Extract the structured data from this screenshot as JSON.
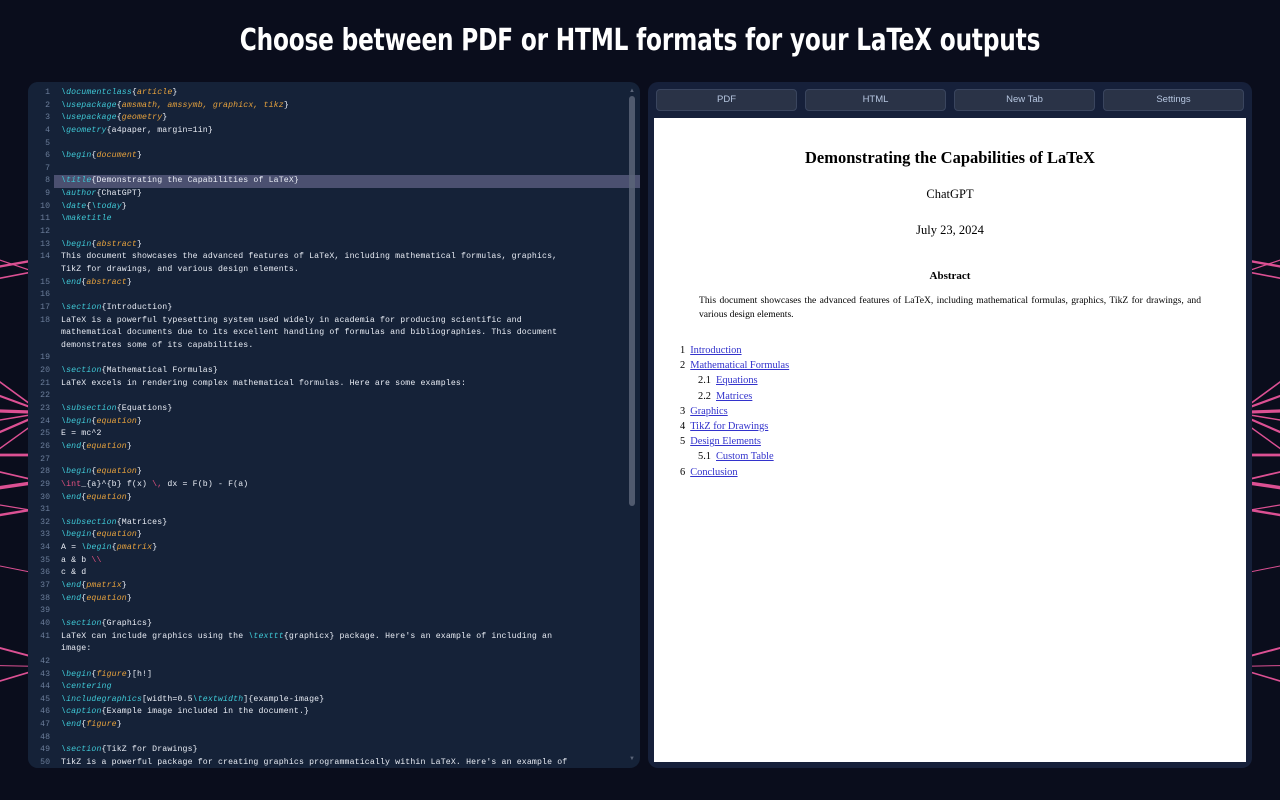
{
  "headline": "Choose between PDF or HTML formats for your LaTeX outputs",
  "colors": {
    "page_bg": "#0a0d1c",
    "panel_bg": "#152238",
    "preview_bg": "#16203a",
    "accent_pink": "#e8549a",
    "cmd_cyan": "#3fc9d6",
    "env_orange": "#e8a33d",
    "math_pink": "#e0507f",
    "link_blue": "#3333cc",
    "button_bg": "#2a3347"
  },
  "toolbar": {
    "buttons": [
      {
        "label": "PDF",
        "name": "pdf-button"
      },
      {
        "label": "HTML",
        "name": "html-button"
      },
      {
        "label": "New Tab",
        "name": "new-tab-button"
      },
      {
        "label": "Settings",
        "name": "settings-button"
      }
    ]
  },
  "editor": {
    "active_line": 8,
    "total_visible_lines": 50,
    "scrollbar": {
      "up_arrow": "▲",
      "down_arrow": "▼"
    },
    "lines": [
      {
        "n": 1,
        "wrap": 1,
        "tokens": [
          {
            "t": "cmd",
            "v": "\\documentclass"
          },
          {
            "t": "brc",
            "v": "{"
          },
          {
            "t": "env",
            "v": "article"
          },
          {
            "t": "brc",
            "v": "}"
          }
        ]
      },
      {
        "n": 2,
        "wrap": 1,
        "tokens": [
          {
            "t": "cmd",
            "v": "\\usepackage"
          },
          {
            "t": "brc",
            "v": "{"
          },
          {
            "t": "env",
            "v": "amsmath, amssymb, graphicx, tikz"
          },
          {
            "t": "brc",
            "v": "}"
          }
        ]
      },
      {
        "n": 3,
        "wrap": 1,
        "tokens": [
          {
            "t": "cmd",
            "v": "\\usepackage"
          },
          {
            "t": "brc",
            "v": "{"
          },
          {
            "t": "env",
            "v": "geometry"
          },
          {
            "t": "brc",
            "v": "}"
          }
        ]
      },
      {
        "n": 4,
        "wrap": 1,
        "tokens": [
          {
            "t": "cmd",
            "v": "\\geometry"
          },
          {
            "t": "txt",
            "v": "{a4paper, margin=1in}"
          }
        ]
      },
      {
        "n": 5,
        "wrap": 1,
        "tokens": []
      },
      {
        "n": 6,
        "wrap": 1,
        "tokens": [
          {
            "t": "cmd",
            "v": "\\begin"
          },
          {
            "t": "brc",
            "v": "{"
          },
          {
            "t": "env",
            "v": "document"
          },
          {
            "t": "brc",
            "v": "}"
          }
        ]
      },
      {
        "n": 7,
        "wrap": 1,
        "tokens": []
      },
      {
        "n": 8,
        "wrap": 1,
        "tokens": [
          {
            "t": "cmd",
            "v": "\\title"
          },
          {
            "t": "txt",
            "v": "{Demonstrating the Capabilities of LaTeX}"
          }
        ]
      },
      {
        "n": 9,
        "wrap": 1,
        "tokens": [
          {
            "t": "cmd",
            "v": "\\author"
          },
          {
            "t": "txt",
            "v": "{ChatGPT}"
          }
        ]
      },
      {
        "n": 10,
        "wrap": 1,
        "tokens": [
          {
            "t": "cmd",
            "v": "\\date"
          },
          {
            "t": "txt",
            "v": "{"
          },
          {
            "t": "cmd",
            "v": "\\today"
          },
          {
            "t": "txt",
            "v": "}"
          }
        ]
      },
      {
        "n": 11,
        "wrap": 1,
        "tokens": [
          {
            "t": "cmd",
            "v": "\\maketitle"
          }
        ]
      },
      {
        "n": 12,
        "wrap": 1,
        "tokens": []
      },
      {
        "n": 13,
        "wrap": 1,
        "tokens": [
          {
            "t": "cmd",
            "v": "\\begin"
          },
          {
            "t": "brc",
            "v": "{"
          },
          {
            "t": "env",
            "v": "abstract"
          },
          {
            "t": "brc",
            "v": "}"
          }
        ]
      },
      {
        "n": 14,
        "wrap": 2,
        "tokens": [
          {
            "t": "txt",
            "v": "This document showcases the advanced features of LaTeX, including mathematical formulas, graphics,\nTikZ for drawings, and various design elements."
          }
        ]
      },
      {
        "n": 15,
        "wrap": 1,
        "tokens": [
          {
            "t": "cmd",
            "v": "\\end"
          },
          {
            "t": "brc",
            "v": "{"
          },
          {
            "t": "env",
            "v": "abstract"
          },
          {
            "t": "brc",
            "v": "}"
          }
        ]
      },
      {
        "n": 16,
        "wrap": 1,
        "tokens": []
      },
      {
        "n": 17,
        "wrap": 1,
        "tokens": [
          {
            "t": "cmd",
            "v": "\\section"
          },
          {
            "t": "txt",
            "v": "{Introduction}"
          }
        ]
      },
      {
        "n": 18,
        "wrap": 3,
        "tokens": [
          {
            "t": "txt",
            "v": "LaTeX is a powerful typesetting system used widely in academia for producing scientific and\nmathematical documents due to its excellent handling of formulas and bibliographies. This document\ndemonstrates some of its capabilities."
          }
        ]
      },
      {
        "n": 19,
        "wrap": 1,
        "tokens": []
      },
      {
        "n": 20,
        "wrap": 1,
        "tokens": [
          {
            "t": "cmd",
            "v": "\\section"
          },
          {
            "t": "txt",
            "v": "{Mathematical Formulas}"
          }
        ]
      },
      {
        "n": 21,
        "wrap": 1,
        "tokens": [
          {
            "t": "txt",
            "v": "LaTeX excels in rendering complex mathematical formulas. Here are some examples:"
          }
        ]
      },
      {
        "n": 22,
        "wrap": 1,
        "tokens": []
      },
      {
        "n": 23,
        "wrap": 1,
        "tokens": [
          {
            "t": "cmd",
            "v": "\\subsection"
          },
          {
            "t": "txt",
            "v": "{Equations}"
          }
        ]
      },
      {
        "n": 24,
        "wrap": 1,
        "tokens": [
          {
            "t": "cmd",
            "v": "\\begin"
          },
          {
            "t": "brc",
            "v": "{"
          },
          {
            "t": "env",
            "v": "equation"
          },
          {
            "t": "brc",
            "v": "}"
          }
        ]
      },
      {
        "n": 25,
        "wrap": 1,
        "tokens": [
          {
            "t": "txt",
            "v": "E = mc^2"
          }
        ]
      },
      {
        "n": 26,
        "wrap": 1,
        "tokens": [
          {
            "t": "cmd",
            "v": "\\end"
          },
          {
            "t": "brc",
            "v": "{"
          },
          {
            "t": "env",
            "v": "equation"
          },
          {
            "t": "brc",
            "v": "}"
          }
        ]
      },
      {
        "n": 27,
        "wrap": 1,
        "tokens": []
      },
      {
        "n": 28,
        "wrap": 1,
        "tokens": [
          {
            "t": "cmd",
            "v": "\\begin"
          },
          {
            "t": "brc",
            "v": "{"
          },
          {
            "t": "env",
            "v": "equation"
          },
          {
            "t": "brc",
            "v": "}"
          }
        ]
      },
      {
        "n": 29,
        "wrap": 1,
        "tokens": [
          {
            "t": "mth",
            "v": "\\int"
          },
          {
            "t": "txt",
            "v": "_{a}^{b} f(x) "
          },
          {
            "t": "mth",
            "v": "\\,"
          },
          {
            "t": "txt",
            "v": " dx = F(b) - F(a)"
          }
        ]
      },
      {
        "n": 30,
        "wrap": 1,
        "tokens": [
          {
            "t": "cmd",
            "v": "\\end"
          },
          {
            "t": "brc",
            "v": "{"
          },
          {
            "t": "env",
            "v": "equation"
          },
          {
            "t": "brc",
            "v": "}"
          }
        ]
      },
      {
        "n": 31,
        "wrap": 1,
        "tokens": []
      },
      {
        "n": 32,
        "wrap": 1,
        "tokens": [
          {
            "t": "cmd",
            "v": "\\subsection"
          },
          {
            "t": "txt",
            "v": "{Matrices}"
          }
        ]
      },
      {
        "n": 33,
        "wrap": 1,
        "tokens": [
          {
            "t": "cmd",
            "v": "\\begin"
          },
          {
            "t": "brc",
            "v": "{"
          },
          {
            "t": "env",
            "v": "equation"
          },
          {
            "t": "brc",
            "v": "}"
          }
        ]
      },
      {
        "n": 34,
        "wrap": 1,
        "tokens": [
          {
            "t": "txt",
            "v": "A = "
          },
          {
            "t": "cmd",
            "v": "\\begin"
          },
          {
            "t": "brc",
            "v": "{"
          },
          {
            "t": "env",
            "v": "pmatrix"
          },
          {
            "t": "brc",
            "v": "}"
          }
        ]
      },
      {
        "n": 35,
        "wrap": 1,
        "tokens": [
          {
            "t": "txt",
            "v": "a & b "
          },
          {
            "t": "mth",
            "v": "\\\\"
          }
        ]
      },
      {
        "n": 36,
        "wrap": 1,
        "tokens": [
          {
            "t": "txt",
            "v": "c & d"
          }
        ]
      },
      {
        "n": 37,
        "wrap": 1,
        "tokens": [
          {
            "t": "cmd",
            "v": "\\end"
          },
          {
            "t": "brc",
            "v": "{"
          },
          {
            "t": "env",
            "v": "pmatrix"
          },
          {
            "t": "brc",
            "v": "}"
          }
        ]
      },
      {
        "n": 38,
        "wrap": 1,
        "tokens": [
          {
            "t": "cmd",
            "v": "\\end"
          },
          {
            "t": "brc",
            "v": "{"
          },
          {
            "t": "env",
            "v": "equation"
          },
          {
            "t": "brc",
            "v": "}"
          }
        ]
      },
      {
        "n": 39,
        "wrap": 1,
        "tokens": []
      },
      {
        "n": 40,
        "wrap": 1,
        "tokens": [
          {
            "t": "cmd",
            "v": "\\section"
          },
          {
            "t": "txt",
            "v": "{Graphics}"
          }
        ]
      },
      {
        "n": 41,
        "wrap": 2,
        "tokens": [
          {
            "t": "txt",
            "v": "LaTeX can include graphics using the "
          },
          {
            "t": "cmd",
            "v": "\\texttt"
          },
          {
            "t": "txt",
            "v": "{graphicx} package. Here's an example of including an\nimage:"
          }
        ]
      },
      {
        "n": 42,
        "wrap": 1,
        "tokens": []
      },
      {
        "n": 43,
        "wrap": 1,
        "tokens": [
          {
            "t": "cmd",
            "v": "\\begin"
          },
          {
            "t": "brc",
            "v": "{"
          },
          {
            "t": "env",
            "v": "figure"
          },
          {
            "t": "brc",
            "v": "}"
          },
          {
            "t": "txt",
            "v": "[h!]"
          }
        ]
      },
      {
        "n": 44,
        "wrap": 1,
        "tokens": [
          {
            "t": "cmd",
            "v": "\\centering"
          }
        ]
      },
      {
        "n": 45,
        "wrap": 1,
        "tokens": [
          {
            "t": "cmd",
            "v": "\\includegraphics"
          },
          {
            "t": "txt",
            "v": "[width=0.5"
          },
          {
            "t": "cmd",
            "v": "\\textwidth"
          },
          {
            "t": "txt",
            "v": "]{example-image}"
          }
        ]
      },
      {
        "n": 46,
        "wrap": 1,
        "tokens": [
          {
            "t": "cmd",
            "v": "\\caption"
          },
          {
            "t": "txt",
            "v": "{Example image included in the document.}"
          }
        ]
      },
      {
        "n": 47,
        "wrap": 1,
        "tokens": [
          {
            "t": "cmd",
            "v": "\\end"
          },
          {
            "t": "brc",
            "v": "{"
          },
          {
            "t": "env",
            "v": "figure"
          },
          {
            "t": "brc",
            "v": "}"
          }
        ]
      },
      {
        "n": 48,
        "wrap": 1,
        "tokens": []
      },
      {
        "n": 49,
        "wrap": 1,
        "tokens": [
          {
            "t": "cmd",
            "v": "\\section"
          },
          {
            "t": "txt",
            "v": "{TikZ for Drawings}"
          }
        ]
      },
      {
        "n": 50,
        "wrap": 1,
        "tokens": [
          {
            "t": "txt",
            "v": "TikZ is a powerful package for creating graphics programmatically within LaTeX. Here's an example of"
          }
        ]
      }
    ]
  },
  "preview": {
    "title": "Demonstrating the Capabilities of LaTeX",
    "author": "ChatGPT",
    "date": "July 23, 2024",
    "abstract_heading": "Abstract",
    "abstract_body": "This document showcases the advanced features of LaTeX, including mathematical formulas, graphics, TikZ for drawings, and various design elements.",
    "toc": [
      {
        "num": "1",
        "label": "Introduction",
        "sub": false
      },
      {
        "num": "2",
        "label": "Mathematical Formulas",
        "sub": false
      },
      {
        "num": "2.1",
        "label": "Equations",
        "sub": true
      },
      {
        "num": "2.2",
        "label": "Matrices",
        "sub": true
      },
      {
        "num": "3",
        "label": "Graphics",
        "sub": false
      },
      {
        "num": "4",
        "label": "TikZ for Drawings",
        "sub": false
      },
      {
        "num": "5",
        "label": "Design Elements",
        "sub": false
      },
      {
        "num": "5.1",
        "label": "Custom Table",
        "sub": true
      },
      {
        "num": "6",
        "label": "Conclusion",
        "sub": false
      }
    ]
  }
}
